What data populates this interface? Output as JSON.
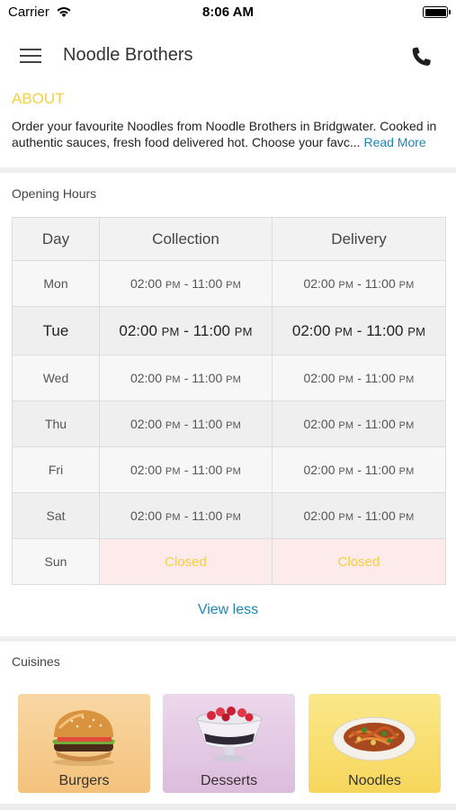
{
  "status_bar": {
    "carrier": "Carrier",
    "time": "8:06 AM",
    "wifi_icon": "wifi-icon",
    "battery_icon": "battery-icon"
  },
  "header": {
    "title": "Noodle Brothers",
    "menu_icon": "hamburger-menu-icon",
    "phone_icon": "phone-icon"
  },
  "about": {
    "title": "ABOUT",
    "text": "Order your favourite Noodles from Noodle Brothers in Bridgwater. Cooked in authentic sauces, fresh food delivered hot. Choose your favc...",
    "read_more": "Read More"
  },
  "opening_hours": {
    "label": "Opening Hours",
    "columns": [
      "Day",
      "Collection",
      "Delivery"
    ],
    "rows": [
      {
        "day": "Mon",
        "collection_open": "02:00",
        "collection_close": "11:00",
        "delivery_open": "02:00",
        "delivery_close": "11:00"
      },
      {
        "day": "Tue",
        "collection_open": "02:00",
        "collection_close": "11:00",
        "delivery_open": "02:00",
        "delivery_close": "11:00"
      },
      {
        "day": "Wed",
        "collection_open": "02:00",
        "collection_close": "11:00",
        "delivery_open": "02:00",
        "delivery_close": "11:00"
      },
      {
        "day": "Thu",
        "collection_open": "02:00",
        "collection_close": "11:00",
        "delivery_open": "02:00",
        "delivery_close": "11:00"
      },
      {
        "day": "Fri",
        "collection_open": "02:00",
        "collection_close": "11:00",
        "delivery_open": "02:00",
        "delivery_close": "11:00"
      },
      {
        "day": "Sat",
        "collection_open": "02:00",
        "collection_close": "11:00",
        "delivery_open": "02:00",
        "delivery_close": "11:00"
      },
      {
        "day": "Sun",
        "collection": "Closed",
        "delivery": "Closed"
      }
    ],
    "pm": "PM",
    "dash": "-",
    "view_less": "View less",
    "closed_color": "#f4cf3c"
  },
  "cuisines": {
    "label": "Cuisines",
    "items": [
      {
        "label": "Burgers",
        "icon": "burger-image"
      },
      {
        "label": "Desserts",
        "icon": "dessert-image"
      },
      {
        "label": "Noodles",
        "icon": "noodles-image"
      }
    ]
  },
  "colors": {
    "accent": "#f4d140",
    "link": "#1d86b5"
  }
}
